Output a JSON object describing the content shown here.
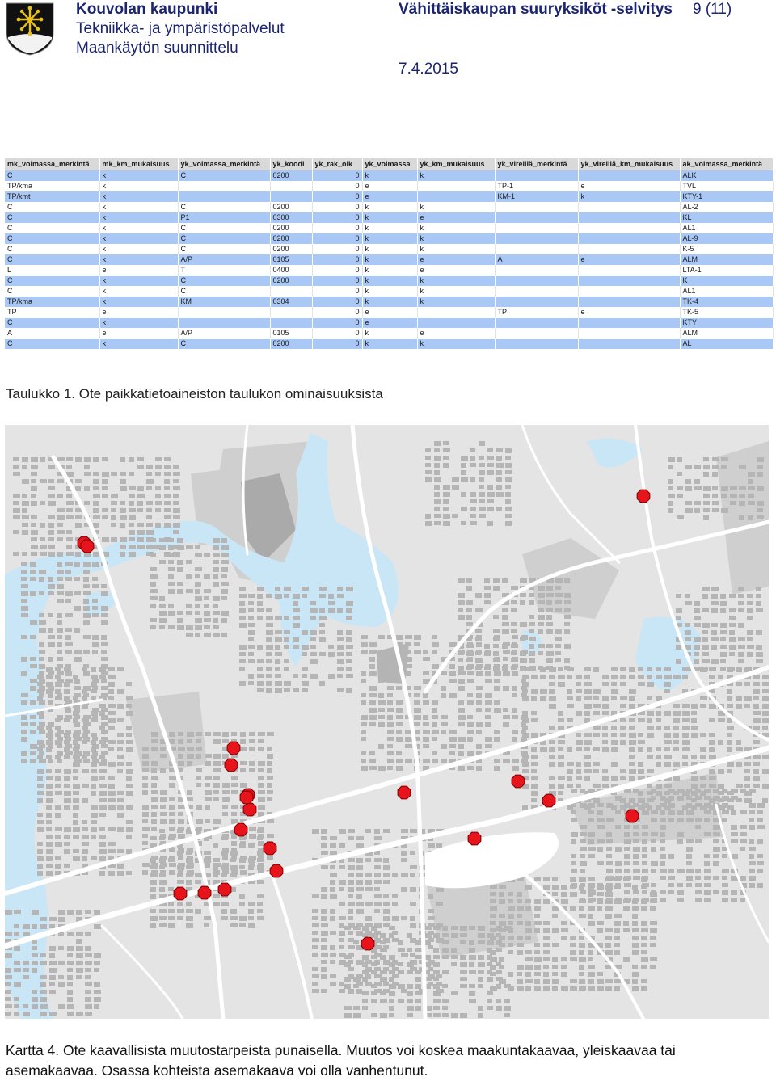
{
  "header": {
    "org": "Kouvolan kaupunki",
    "dept": "Tekniikka- ja ympäristöpalvelut",
    "unit": "Maankäytön suunnittelu",
    "title": "Vähittäiskaupan suuryksiköt -selvitys",
    "page": "9 (11)",
    "date": "7.4.2015"
  },
  "table": {
    "columns": [
      "mk_voimassa_merkintä",
      "mk_km_mukaisuus",
      "yk_voimassa_merkintä",
      "yk_koodi",
      "yk_rak_oik",
      "yk_voimassa",
      "yk_km_mukaisuus",
      "yk_vireillä_merkintä",
      "yk_vireillä_km_mukaisuus",
      "ak_voimassa_merkintä"
    ],
    "rows": [
      [
        "C",
        "k",
        "C",
        "0200",
        "0",
        "k",
        "k",
        "",
        "",
        "ALK"
      ],
      [
        "TP/kma",
        "k",
        "",
        "",
        "0",
        "e",
        "",
        "TP-1",
        "e",
        "TVL"
      ],
      [
        "TP/kmt",
        "k",
        "",
        "",
        "0",
        "e",
        "",
        "KM-1",
        "k",
        "KTY-1"
      ],
      [
        "C",
        "k",
        "C",
        "0200",
        "0",
        "k",
        "k",
        "",
        "",
        "AL-2"
      ],
      [
        "C",
        "k",
        "P1",
        "0300",
        "0",
        "k",
        "e",
        "",
        "",
        "KL"
      ],
      [
        "C",
        "k",
        "C",
        "0200",
        "0",
        "k",
        "k",
        "",
        "",
        "AL1"
      ],
      [
        "C",
        "k",
        "C",
        "0200",
        "0",
        "k",
        "k",
        "",
        "",
        "AL-9"
      ],
      [
        "C",
        "k",
        "C",
        "0200",
        "0",
        "k",
        "k",
        "",
        "",
        "K-5"
      ],
      [
        "C",
        "k",
        "A/P",
        "0105",
        "0",
        "k",
        "e",
        "A",
        "e",
        "ALM"
      ],
      [
        "L",
        "e",
        "T",
        "0400",
        "0",
        "k",
        "e",
        "",
        "",
        "LTA-1"
      ],
      [
        "C",
        "k",
        "C",
        "0200",
        "0",
        "k",
        "k",
        "",
        "",
        "K"
      ],
      [
        "C",
        "k",
        "C",
        "",
        "0",
        "k",
        "k",
        "",
        "",
        "AL1"
      ],
      [
        "TP/kma",
        "k",
        "KM",
        "0304",
        "0",
        "k",
        "k",
        "",
        "",
        "TK-4"
      ],
      [
        "TP",
        "e",
        "",
        "",
        "0",
        "e",
        "",
        "TP",
        "e",
        "TK-5"
      ],
      [
        "C",
        "k",
        "",
        "",
        "0",
        "e",
        "",
        "",
        "",
        "KTY"
      ],
      [
        "A",
        "e",
        "A/P",
        "0105",
        "0",
        "k",
        "e",
        "",
        "",
        "ALM"
      ],
      [
        "C",
        "k",
        "C",
        "0200",
        "0",
        "k",
        "k",
        "",
        "",
        "AL"
      ]
    ],
    "selected_rows": [
      0,
      2,
      4,
      6,
      8,
      10,
      12,
      14,
      16
    ]
  },
  "captions": {
    "table": "Taulukko 1. Ote paikkatietoaineiston taulukon ominaisuuksista",
    "map": "Kartta 4. Ote kaavallisista muutostarpeista punaisella. Muutos voi koskea maakuntakaavaa, yleiskaavaa tai asemakaavaa. Osassa kohteista asemakaava voi olla vanhentunut."
  },
  "map": {
    "marker_color": "#e8141c",
    "water_color": "#c9e6f7",
    "road_color": "#ffffff",
    "built_color": "#b4b4b4",
    "marker_count": 20
  }
}
